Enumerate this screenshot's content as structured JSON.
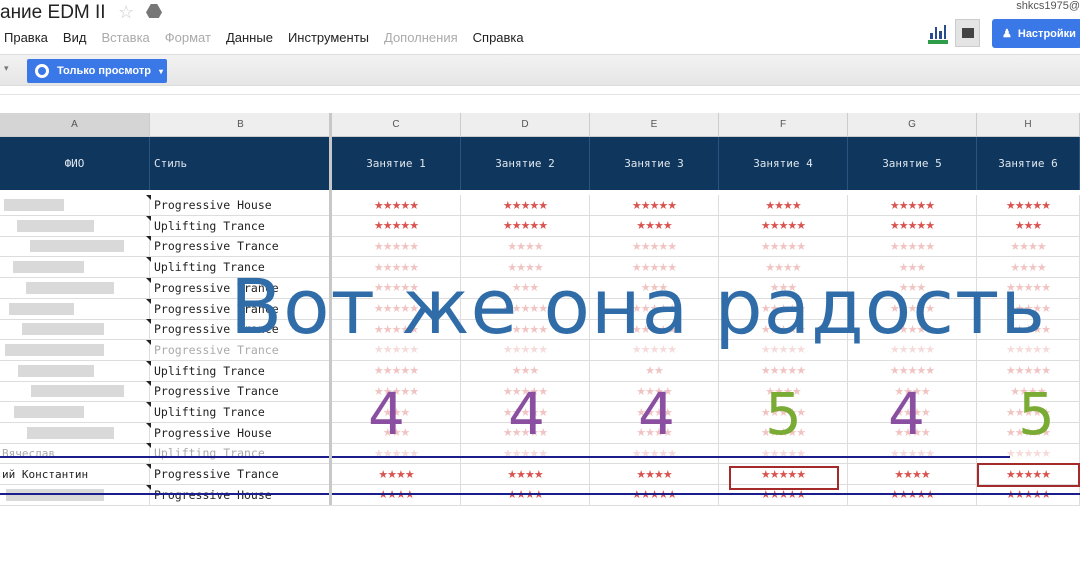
{
  "header": {
    "title": "ание EDM II",
    "user": "shkcs1975@",
    "share_label": "Настройки"
  },
  "menu": [
    {
      "label": "Правка",
      "disabled": false
    },
    {
      "label": "Вид",
      "disabled": false
    },
    {
      "label": "Вставка",
      "disabled": true
    },
    {
      "label": "Формат",
      "disabled": true
    },
    {
      "label": "Данные",
      "disabled": false
    },
    {
      "label": "Инструменты",
      "disabled": false
    },
    {
      "label": "Дополнения",
      "disabled": true
    },
    {
      "label": "Справка",
      "disabled": false
    }
  ],
  "toolbar": {
    "view_mode": "Только просмотр"
  },
  "columns": [
    "A",
    "B",
    "C",
    "D",
    "E",
    "F",
    "G",
    "H"
  ],
  "headers": [
    "ФИО",
    "Стиль",
    "Занятие 1",
    "Занятие 2",
    "Занятие 3",
    "Занятие 4",
    "Занятие 5",
    "Занятие 6"
  ],
  "rows": [
    {
      "name": "",
      "style": "Progressive House",
      "stars": [
        5,
        5,
        5,
        4,
        5,
        5
      ],
      "fade": ""
    },
    {
      "name": "",
      "style": "Uplifting Trance",
      "stars": [
        5,
        5,
        4,
        5,
        5,
        3
      ],
      "fade": ""
    },
    {
      "name": "",
      "style": "Progressive Trance",
      "stars": [
        5,
        4,
        5,
        5,
        5,
        4
      ],
      "fade": "fade"
    },
    {
      "name": "",
      "style": "Uplifting Trance",
      "stars": [
        5,
        4,
        5,
        4,
        3,
        4
      ],
      "fade": "fade"
    },
    {
      "name": "",
      "style": "Progressive Trance",
      "stars": [
        5,
        3,
        3,
        3,
        3,
        5
      ],
      "fade": "fade"
    },
    {
      "name": "",
      "style": "Progressive Trance",
      "stars": [
        5,
        5,
        5,
        5,
        5,
        5
      ],
      "fade": "fade"
    },
    {
      "name": "",
      "style": "Progressive Trance",
      "stars": [
        5,
        5,
        5,
        5,
        5,
        5
      ],
      "fade": "fade"
    },
    {
      "name": "",
      "style": "Progressive Trance",
      "stars": [
        5,
        5,
        5,
        5,
        5,
        5
      ],
      "fade": "fade2 ghost"
    },
    {
      "name": "",
      "style": "Uplifting Trance",
      "stars": [
        5,
        3,
        2,
        5,
        5,
        5
      ],
      "fade": "fade"
    },
    {
      "name": "",
      "style": "Progressive Trance",
      "stars": [
        5,
        5,
        4,
        4,
        4,
        4
      ],
      "fade": "fade"
    },
    {
      "name": "",
      "style": "Uplifting Trance",
      "stars": [
        3,
        5,
        4,
        5,
        4,
        5
      ],
      "fade": "fade"
    },
    {
      "name": "",
      "style": "Progressive House",
      "stars": [
        3,
        5,
        4,
        5,
        4,
        5
      ],
      "fade": "fade"
    },
    {
      "name": "Вячеслав",
      "style": "Uplifting Trance",
      "stars": [
        5,
        5,
        5,
        5,
        5,
        5
      ],
      "fade": "fade2 ghost"
    },
    {
      "name": "ий Константин",
      "style": "Progressive Trance",
      "stars": [
        4,
        4,
        4,
        5,
        4,
        5
      ],
      "fade": ""
    },
    {
      "name": "",
      "style": "Progressive House",
      "stars": [
        4,
        4,
        5,
        5,
        5,
        5
      ],
      "fade": ""
    }
  ],
  "overlay": {
    "caption": "Вот же она радость",
    "scores": [
      "4",
      "4",
      "4",
      "5",
      "4",
      "5"
    ]
  },
  "colors": {
    "caption": "#2f6ca8",
    "score_4": "#8a4fa0",
    "score_5": "#7aab35",
    "header_bg": "#0f365c",
    "star": "#d9534f"
  }
}
